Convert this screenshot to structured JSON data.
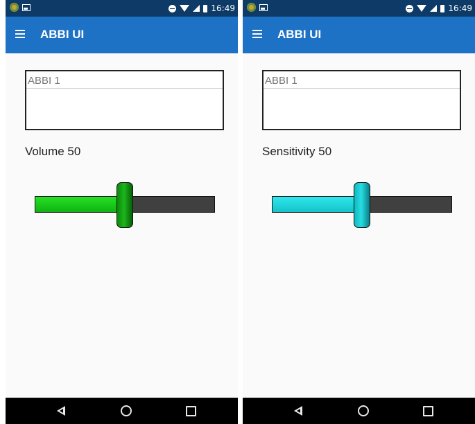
{
  "screens": [
    {
      "status_bar": {
        "time": "16:49"
      },
      "app_bar": {
        "title": "ABBI UI"
      },
      "device_name": "ABBI 1",
      "slider": {
        "label": "Volume 50",
        "value": 50,
        "max": 100,
        "color": "#17c417"
      }
    },
    {
      "status_bar": {
        "time": "16:49"
      },
      "app_bar": {
        "title": "ABBI UI"
      },
      "device_name": "ABBI 1",
      "slider": {
        "label": "Sensitivity 50",
        "value": 50,
        "max": 100,
        "color": "#1ed7dc"
      }
    }
  ],
  "colors": {
    "status_bar": "#0d3a66",
    "app_bar": "#1e72c6",
    "nav_bar": "#000000",
    "track": "#404040"
  },
  "icons": {
    "status_left": [
      "app-notification-icon",
      "image-notification-icon"
    ],
    "status_right": [
      "do-not-disturb-icon",
      "wifi-icon",
      "cell-signal-icon",
      "battery-icon"
    ],
    "app_bar": "hamburger-menu-icon",
    "nav_bar": [
      "back-icon",
      "home-icon",
      "recents-icon"
    ]
  }
}
